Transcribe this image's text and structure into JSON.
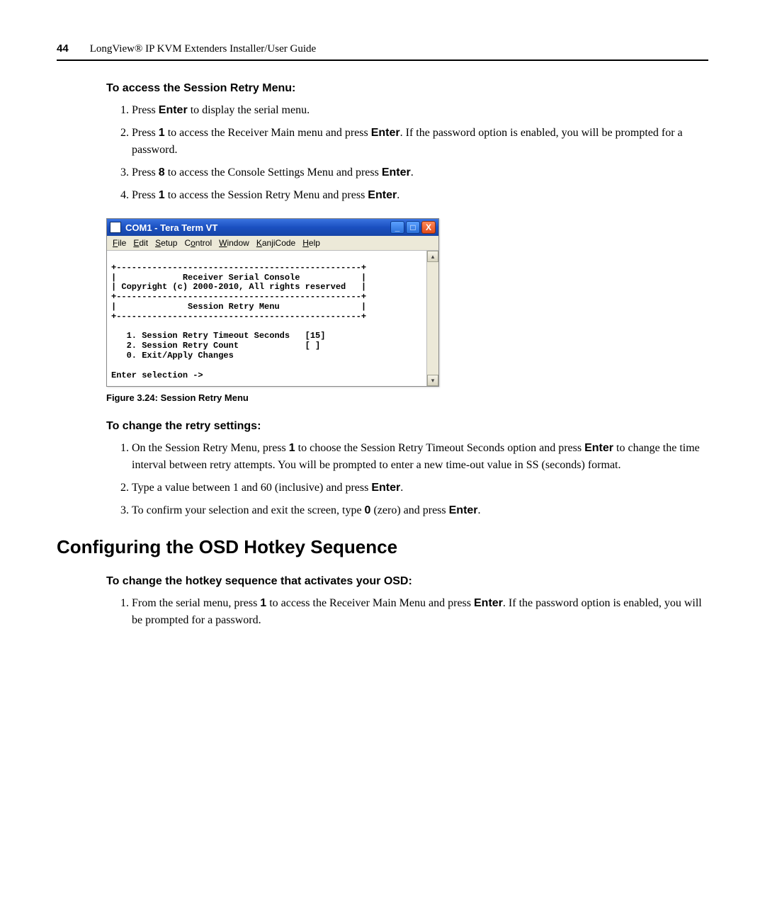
{
  "header": {
    "page_number": "44",
    "guide_title": "LongView® IP KVM Extenders Installer/User Guide"
  },
  "section1": {
    "heading": "To access the Session Retry Menu:",
    "steps": [
      {
        "pre": "Press ",
        "bold1": "Enter",
        "post1": " to display the serial menu."
      },
      {
        "pre": "Press ",
        "bold1": "1",
        "mid": " to access the Receiver Main menu and press ",
        "bold2": "Enter",
        "post": ". If the password option is enabled, you will be prompted for a password."
      },
      {
        "pre": "Press ",
        "bold1": "8",
        "mid": " to access the Console Settings Menu and press ",
        "bold2": "Enter",
        "post": "."
      },
      {
        "pre": "Press ",
        "bold1": "1",
        "mid": " to access the Session Retry Menu and press ",
        "bold2": "Enter",
        "post": "."
      }
    ]
  },
  "terminal": {
    "title": "COM1 - Tera Term VT",
    "menus": {
      "file": "File",
      "edit": "Edit",
      "setup": "Setup",
      "control": "Control",
      "window": "Window",
      "kanji": "KanjiCode",
      "help": "Help"
    },
    "body": "\n+------------------------------------------------+\n|             Receiver Serial Console            |\n| Copyright (c) 2000-2010, All rights reserved   |\n+------------------------------------------------+\n|              Session Retry Menu                |\n+------------------------------------------------+\n\n   1. Session Retry Timeout Seconds   [15]\n   2. Session Retry Count             [ ]\n   0. Exit/Apply Changes\n\nEnter selection ->"
  },
  "figure_caption": "Figure 3.24: Session Retry Menu",
  "section2": {
    "heading": "To change the retry settings:",
    "steps": [
      {
        "pre": "On the Session Retry Menu, press ",
        "bold1": "1",
        "mid": " to choose the Session Retry Timeout Seconds option and press ",
        "bold2": "Enter",
        "post": " to change the time interval between retry attempts. You will be prompted to enter a new time-out value in SS (seconds) format."
      },
      {
        "pre": "Type a value between 1 and 60 (inclusive) and press ",
        "bold1": "Enter",
        "post1": "."
      },
      {
        "pre": "To confirm your selection and exit the screen, type ",
        "bold1": "0",
        "mid": " (zero) and press ",
        "bold2": "Enter",
        "post": "."
      }
    ]
  },
  "main_heading": "Configuring the OSD Hotkey Sequence",
  "section3": {
    "heading": "To change the hotkey sequence that activates your OSD:",
    "steps": [
      {
        "pre": "From the serial menu, press ",
        "bold1": "1",
        "mid": " to access the Receiver Main Menu and press ",
        "bold2": "Enter",
        "post": ". If the password option is enabled, you will be prompted for a password."
      }
    ]
  }
}
